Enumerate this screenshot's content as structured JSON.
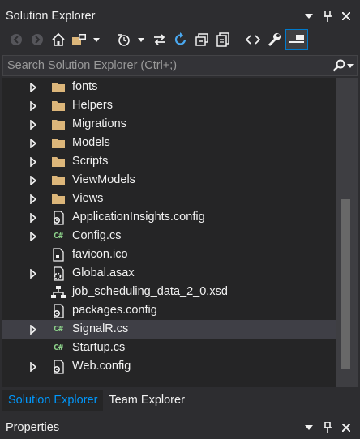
{
  "explorer": {
    "title": "Solution Explorer",
    "buttons": [
      "menu-arrow-icon",
      "pin-icon",
      "close-icon"
    ]
  },
  "toolbar": {
    "icons": [
      "back-icon",
      "forward-icon",
      "home-icon",
      "switch-views-icon",
      "dropdown-arrow-icon",
      "pending-changes-filter-icon",
      "sync-icon",
      "refresh-icon",
      "collapse-all-icon",
      "show-all-files-icon",
      "view-code-icon",
      "properties-icon",
      "preview-selected-icon"
    ]
  },
  "search": {
    "placeholder": "Search Solution Explorer (Ctrl+;)"
  },
  "tree": {
    "items": [
      {
        "label": "fonts",
        "icon": "folder-icon",
        "expandable": true
      },
      {
        "label": "Helpers",
        "icon": "folder-icon",
        "expandable": true
      },
      {
        "label": "Migrations",
        "icon": "folder-icon",
        "expandable": true
      },
      {
        "label": "Models",
        "icon": "folder-icon",
        "expandable": true
      },
      {
        "label": "Scripts",
        "icon": "folder-icon",
        "expandable": true
      },
      {
        "label": "ViewModels",
        "icon": "folder-icon",
        "expandable": true
      },
      {
        "label": "Views",
        "icon": "folder-icon",
        "expandable": true
      },
      {
        "label": "ApplicationInsights.config",
        "icon": "config-file-icon",
        "expandable": true
      },
      {
        "label": "Config.cs",
        "icon": "csharp-file-icon",
        "expandable": true
      },
      {
        "label": "favicon.ico",
        "icon": "icon-file-icon",
        "expandable": false
      },
      {
        "label": "Global.asax",
        "icon": "asax-file-icon",
        "expandable": true
      },
      {
        "label": "job_scheduling_data_2_0.xsd",
        "icon": "xsd-file-icon",
        "expandable": false
      },
      {
        "label": "packages.config",
        "icon": "config-file-icon",
        "expandable": false
      },
      {
        "label": "SignalR.cs",
        "icon": "csharp-file-icon",
        "expandable": true,
        "selected": true
      },
      {
        "label": "Startup.cs",
        "icon": "csharp-file-icon",
        "expandable": false
      },
      {
        "label": "Web.config",
        "icon": "config-file-icon",
        "expandable": true
      }
    ]
  },
  "tabs": [
    {
      "label": "Solution Explorer",
      "active": true
    },
    {
      "label": "Team Explorer",
      "active": false
    }
  ],
  "properties": {
    "title": "Properties",
    "buttons": [
      "menu-arrow-icon",
      "pin-icon",
      "close-icon"
    ]
  },
  "colors": {
    "background": "#2d2d30",
    "tree_background": "#252526",
    "accent": "#007acc",
    "active_tab_text": "#0097fb",
    "folder": "#dcb67a",
    "csharp": "#8dd28a",
    "refresh": "#4aa8f0"
  }
}
